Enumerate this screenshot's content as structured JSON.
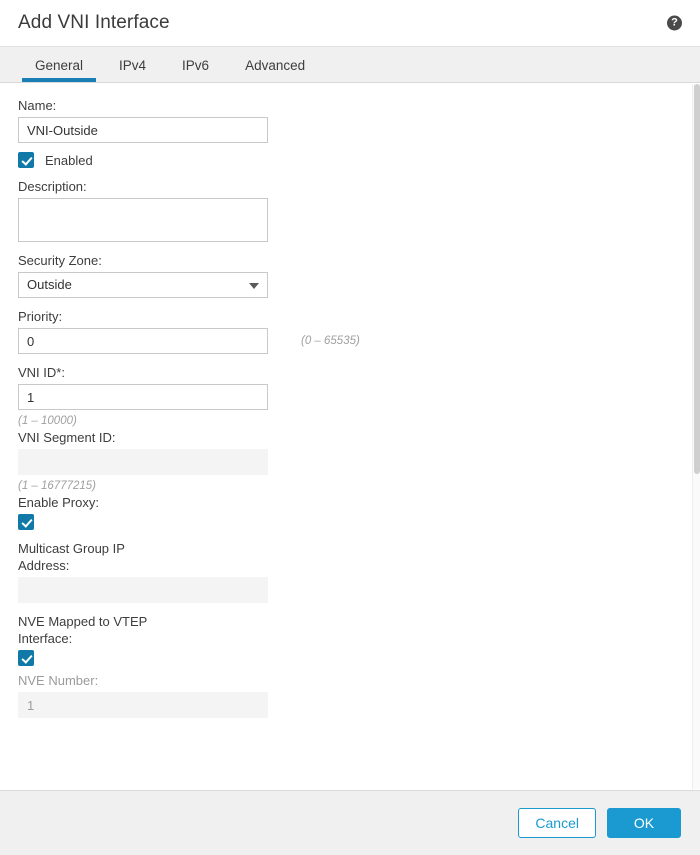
{
  "dialog": {
    "title": "Add VNI Interface",
    "help_icon": "help-circle-icon",
    "help_glyph": "?"
  },
  "tabs": [
    {
      "label": "General",
      "active": true
    },
    {
      "label": "IPv4",
      "active": false
    },
    {
      "label": "IPv6",
      "active": false
    },
    {
      "label": "Advanced",
      "active": false
    }
  ],
  "form": {
    "name": {
      "label": "Name:",
      "value": "VNI-Outside",
      "placeholder": ""
    },
    "enabled": {
      "label": "Enabled",
      "checked": true
    },
    "description": {
      "label": "Description:",
      "value": "",
      "placeholder": ""
    },
    "security_zone": {
      "label": "Security Zone:",
      "value": "Outside",
      "options": [
        "Outside"
      ]
    },
    "priority": {
      "label": "Priority:",
      "value": "0",
      "hint": "(0 – 65535)"
    },
    "vni_id": {
      "label": "VNI ID*:",
      "value": "1",
      "hint": "(1 – 10000)"
    },
    "vni_segment_id": {
      "label": "VNI Segment ID:",
      "value": "",
      "hint": "(1 – 16777215)",
      "disabled": true
    },
    "enable_proxy": {
      "label": "Enable Proxy:",
      "checked": true
    },
    "multicast_group_ip": {
      "label": "Multicast Group IP Address:",
      "value": "",
      "disabled": true
    },
    "nve_mapped": {
      "label": "NVE Mapped to VTEP Interface:",
      "checked": true
    },
    "nve_number": {
      "label": "NVE Number:",
      "value": "1",
      "disabled": true
    }
  },
  "footer": {
    "cancel_label": "Cancel",
    "ok_label": "OK"
  },
  "colors": {
    "accent": "#1a9ad1",
    "tab_underline": "#1a7fb5",
    "checkbox": "#1079a8",
    "footer_bg": "#f0f0f0",
    "disabled_field_bg": "#f4f4f4"
  }
}
